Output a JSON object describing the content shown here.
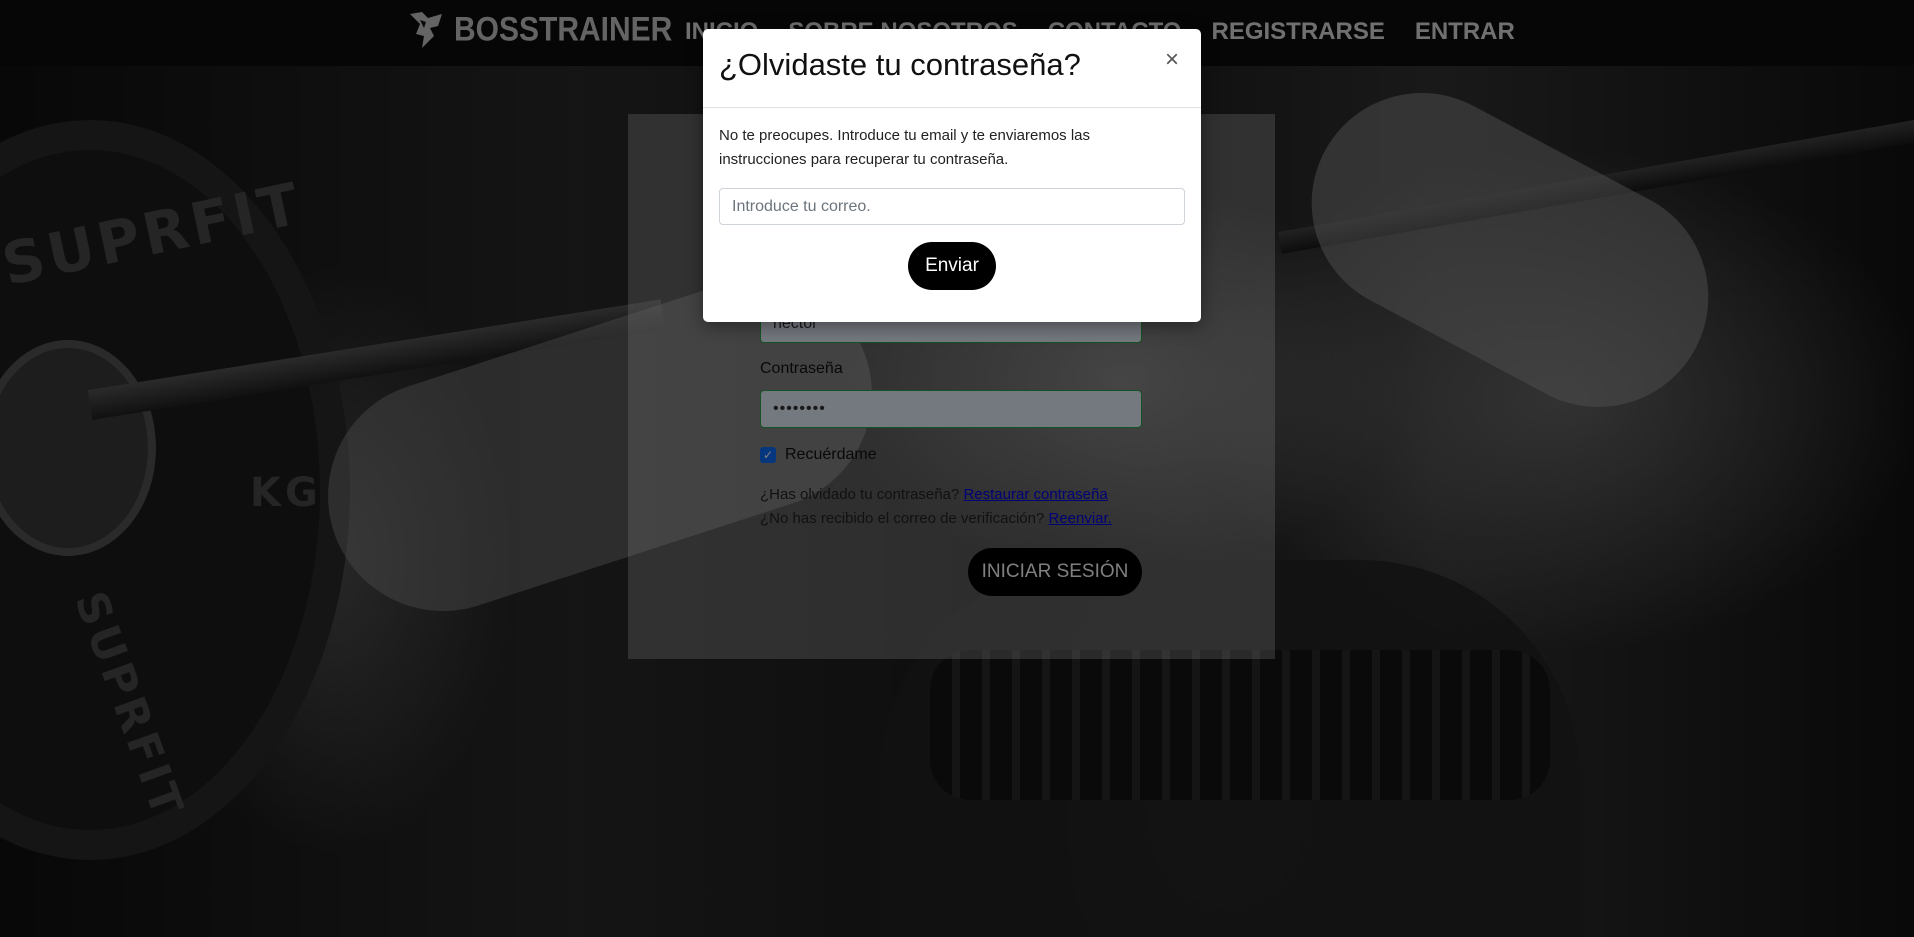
{
  "navbar": {
    "brand": "BOSSTRAINER",
    "links": [
      "INICIO",
      "SOBRE NOSOTROS",
      "CONTACTO",
      "REGISTRARSE",
      "ENTRAR"
    ]
  },
  "login": {
    "username_value": "hector",
    "password_label": "Contraseña",
    "password_value": "••••••••",
    "remember_label": "Recuérdame",
    "forgot_text": "¿Has olvidado tu contraseña?",
    "forgot_link": "Restaurar contraseña",
    "resend_text": "¿No has recibido el correo de verificación?",
    "resend_link": "Reenviar.",
    "submit_label": "INICIAR SESIÓN"
  },
  "modal": {
    "title": "¿Olvidaste tu contraseña?",
    "close_symbol": "×",
    "body_text": "No te preocupes. Introduce tu email y te enviaremos las instrucciones para recuperar tu contraseña.",
    "email_placeholder": "Introduce tu correo.",
    "send_label": "Enviar"
  },
  "background": {
    "plate_text_1": "SUPRFIT",
    "plate_text_2": "KG",
    "plate_text_3": "SUPRFIT"
  }
}
